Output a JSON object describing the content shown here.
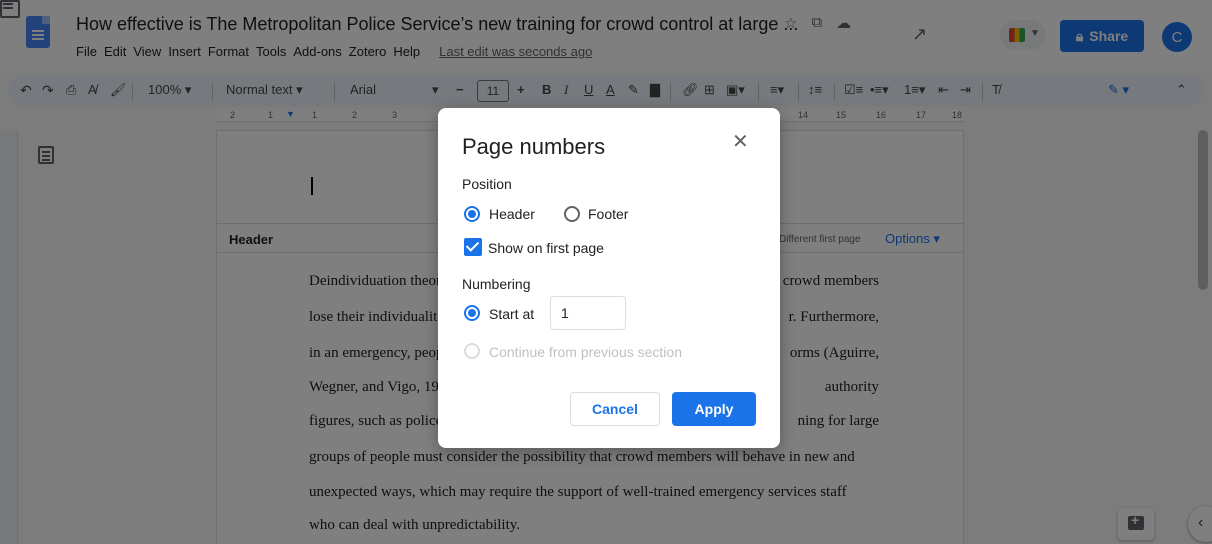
{
  "header": {
    "title": "How effective is The Metropolitan Police Service’s new training for crowd control at large ...",
    "menu": [
      "File",
      "Edit",
      "View",
      "Insert",
      "Format",
      "Tools",
      "Add-ons",
      "Zotero",
      "Help"
    ],
    "last_edit": "Last edit was seconds ago",
    "share_label": "Share",
    "avatar_initial": "C"
  },
  "toolbar": {
    "zoom": "100%",
    "style": "Normal text",
    "font": "Arial",
    "font_size": "11"
  },
  "ruler": {
    "ticks": [
      "2",
      "1",
      "1",
      "2",
      "3",
      "14",
      "15",
      "16",
      "17",
      "18"
    ]
  },
  "document": {
    "header_label": "Header",
    "different_first_page": "Different first page",
    "options_label": "Options",
    "lines": [
      {
        "left": "Deindividuation theor",
        "right": "crowd members"
      },
      {
        "left": "lose their individualit",
        "right": "r.  Furthermore,"
      },
      {
        "left": "in an emergency, peop",
        "right": "orms (Aguirre,"
      },
      {
        "left": "Wegner, and Vigo, 19",
        "right": "authority"
      },
      {
        "left": "figures, such as police",
        "right": "ning for large"
      },
      {
        "left": "groups of people must consider the possibility that crowd members will behave in new and",
        "right": ""
      },
      {
        "left": "unexpected ways, which may require the support of well-trained emergency services staff",
        "right": ""
      },
      {
        "left": "who can deal with unpredictability.",
        "right": ""
      }
    ]
  },
  "dialog": {
    "title": "Page numbers",
    "position_label": "Position",
    "header_option": "Header",
    "footer_option": "Footer",
    "show_first_page": "Show on first page",
    "numbering_label": "Numbering",
    "start_at_label": "Start at",
    "start_at_value": "1",
    "continue_label": "Continue from previous section",
    "cancel_label": "Cancel",
    "apply_label": "Apply"
  },
  "colors": {
    "accent": "#1a73e8",
    "overlay": "rgba(0,0,0,0.5)"
  }
}
